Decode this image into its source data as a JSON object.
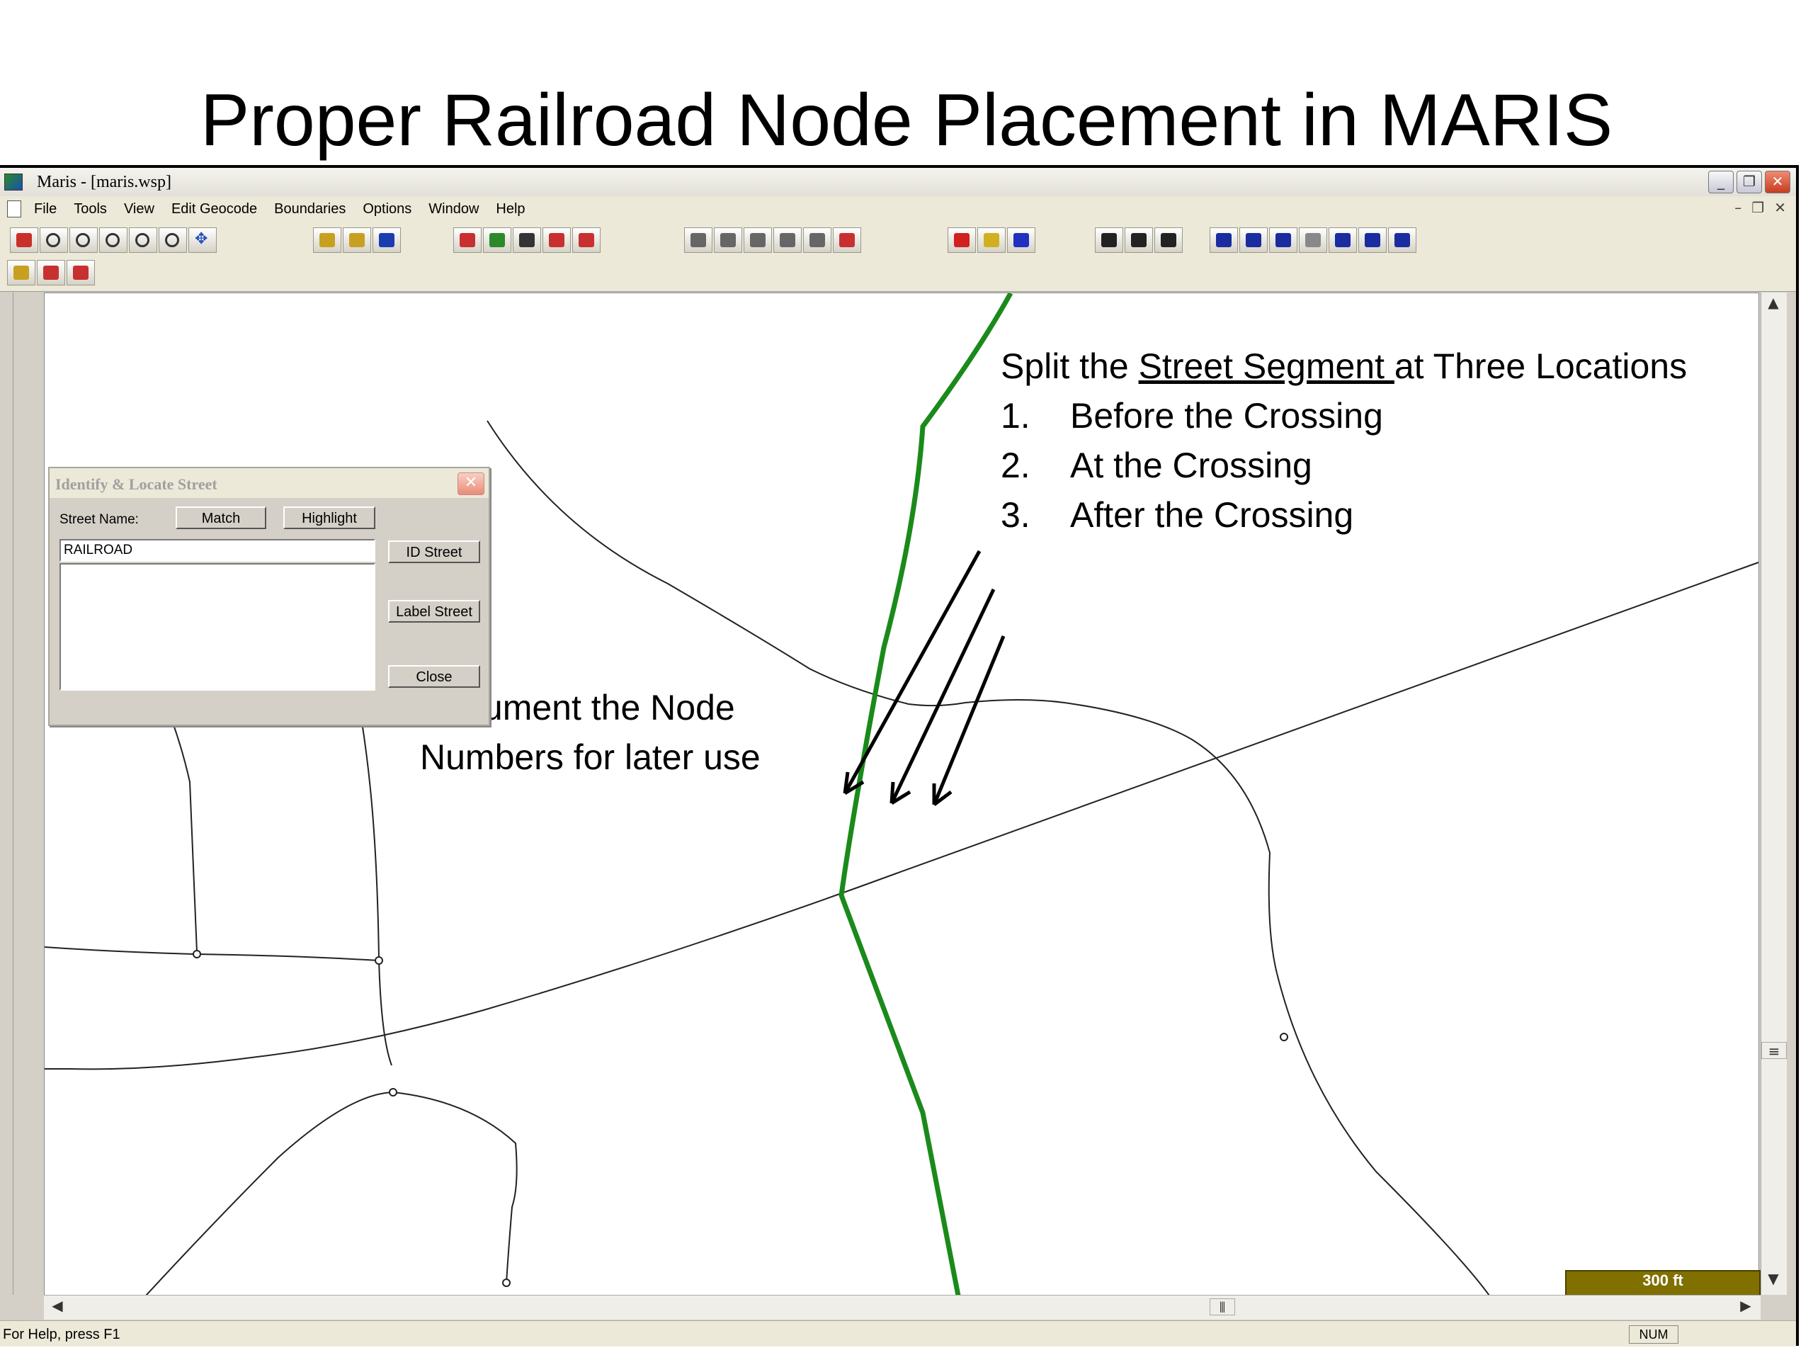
{
  "slide": {
    "title": "Proper Railroad Node Placement in MARIS"
  },
  "window": {
    "title": "Maris - [maris.wsp]"
  },
  "menu": {
    "items": [
      "File",
      "Tools",
      "View",
      "Edit Geocode",
      "Boundaries",
      "Options",
      "Window",
      "Help"
    ]
  },
  "dialog": {
    "title": "Identify & Locate Street",
    "street_name_label": "Street Name:",
    "match_label": "Match",
    "highlight_label": "Highlight",
    "input_value": "RAILROAD",
    "id_street_label": "ID Street",
    "label_street_label": "Label Street",
    "close_label": "Close"
  },
  "annotations": {
    "split_prefix": "Split the ",
    "split_underlined": "Street Segment ",
    "split_suffix": "at Three Locations",
    "steps": [
      {
        "num": "1.",
        "text": "Before the Crossing"
      },
      {
        "num": "2.",
        "text": "At the Crossing"
      },
      {
        "num": "3.",
        "text": "After the Crossing"
      }
    ],
    "document_line1": "Document the Node",
    "document_line2": "Numbers for later use"
  },
  "scale": {
    "label": "300 ft"
  },
  "status": {
    "help_text": "For Help, press F1",
    "num_indicator": "NUM"
  },
  "colors": {
    "railroad": "#1a8a1a",
    "scale_bar": "#807000"
  }
}
